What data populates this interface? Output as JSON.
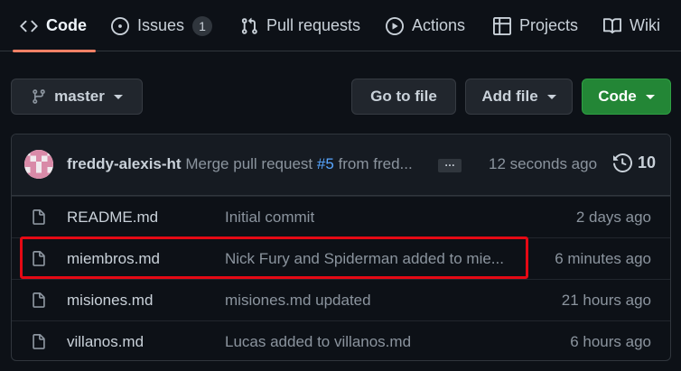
{
  "tabs": [
    {
      "label": "Code",
      "icon": "code-icon",
      "active": true
    },
    {
      "label": "Issues",
      "icon": "issue-opened-icon",
      "count": "1"
    },
    {
      "label": "Pull requests",
      "icon": "git-pull-request-icon"
    },
    {
      "label": "Actions",
      "icon": "play-icon"
    },
    {
      "label": "Projects",
      "icon": "table-icon"
    },
    {
      "label": "Wiki",
      "icon": "book-icon"
    }
  ],
  "toolbar": {
    "branch": "master",
    "go_to_file": "Go to file",
    "add_file": "Add file",
    "code": "Code"
  },
  "latest_commit": {
    "author": "freddy-alexis-ht",
    "message_prefix": "Merge pull request",
    "pr_ref": "#5",
    "message_suffix": "from fred...",
    "ellipsis": "…",
    "time": "12 seconds ago",
    "commit_count": "10"
  },
  "files": [
    {
      "name": "README.md",
      "message": "Initial commit",
      "age": "2 days ago"
    },
    {
      "name": "miembros.md",
      "message": "Nick Fury and Spiderman added to mie...",
      "age": "6 minutes ago",
      "highlighted": true
    },
    {
      "name": "misiones.md",
      "message": "misiones.md updated",
      "age": "21 hours ago"
    },
    {
      "name": "villanos.md",
      "message": "Lucas added to villanos.md",
      "age": "6 hours ago"
    }
  ],
  "colors": {
    "background": "#0d1117",
    "accent_underline": "#f78166",
    "primary_button": "#238636",
    "link": "#58a6ff",
    "highlight_box": "#e50914"
  }
}
